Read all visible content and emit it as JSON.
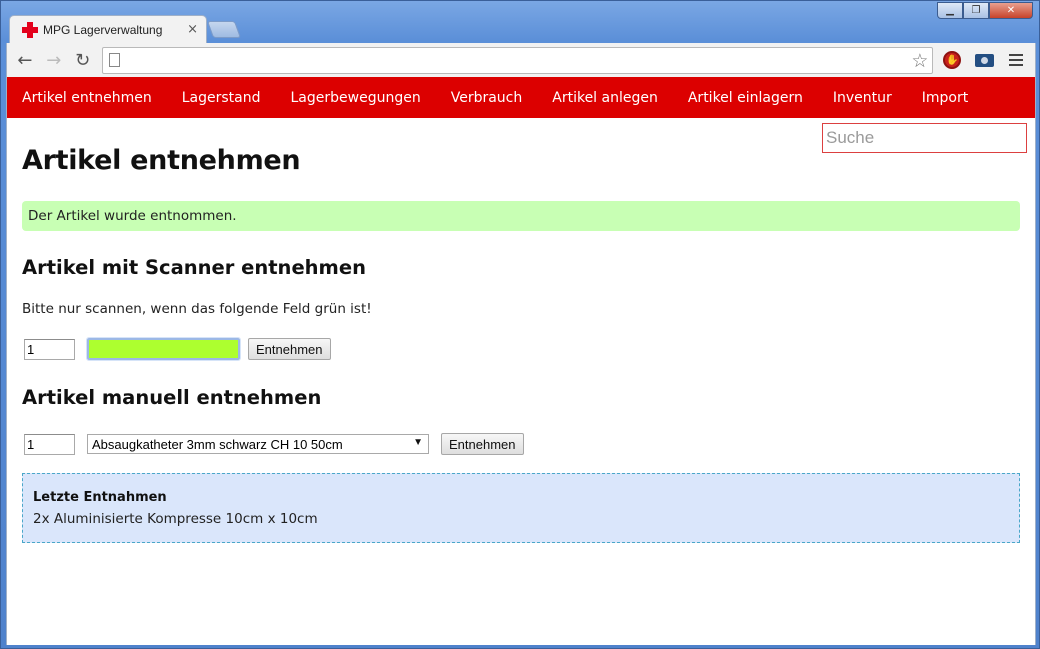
{
  "browser": {
    "tab_title": "MPG Lagerverwaltung",
    "tab_close": "×",
    "url": ""
  },
  "icons": {
    "tab": "red-cross-icon",
    "back": "back-arrow-icon",
    "forward": "forward-arrow-icon",
    "reload": "reload-icon",
    "page": "page-icon",
    "bookmark": "star-icon",
    "ext1": "stop-sign-icon",
    "ext2": "camera-icon",
    "menu": "hamburger-menu-icon"
  },
  "colors": {
    "nav_background": "#dc0000",
    "success_background": "#c8ffb4",
    "scanner_field": "#adff2f",
    "recent_background": "#dae6fb"
  },
  "nav": {
    "items": [
      "Artikel entnehmen",
      "Lagerstand",
      "Lagerbewegungen",
      "Verbrauch",
      "Artikel anlegen",
      "Artikel einlagern",
      "Inventur",
      "Import"
    ]
  },
  "search": {
    "placeholder": "Suche"
  },
  "page": {
    "title": "Artikel entnehmen",
    "alert": "Der Artikel wurde entnommen."
  },
  "scanner": {
    "heading": "Artikel mit Scanner entnehmen",
    "hint": "Bitte nur scannen, wenn das folgende Feld grün ist!",
    "quantity": "1",
    "barcode_value": "",
    "button": "Entnehmen"
  },
  "manual": {
    "heading": "Artikel manuell entnehmen",
    "quantity": "1",
    "selected_article": "Absaugkatheter 3mm schwarz CH 10 50cm",
    "button": "Entnehmen"
  },
  "recent": {
    "title": "Letzte Entnahmen",
    "items": [
      "2x Aluminisierte Kompresse 10cm x 10cm"
    ]
  }
}
